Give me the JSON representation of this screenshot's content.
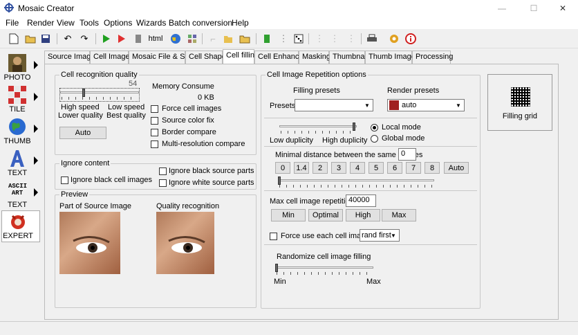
{
  "window": {
    "title": "Mosaic Creator",
    "minimize": "—",
    "maximize": "☐",
    "close": "✕"
  },
  "menu": [
    "File",
    "Render",
    "View",
    "Tools",
    "Options",
    "Wizards",
    "Batch conversion",
    "Help"
  ],
  "toolbar": {
    "html_label": "html"
  },
  "sidebar": {
    "items": [
      {
        "label": "PHOTO"
      },
      {
        "label": "TILE"
      },
      {
        "label": "THUMB"
      },
      {
        "label": "TEXT"
      },
      {
        "label": "TEXT",
        "icon_text": "ASCII ART"
      },
      {
        "label": "EXPERT"
      }
    ]
  },
  "tabs": [
    "Source Image",
    "Cell Images",
    "Mosaic File & Size",
    "Cell Shape",
    "Cell filling",
    "Cell Enhance",
    "Masking",
    "Thumbnail",
    "Thumb Images",
    "Processing"
  ],
  "active_tab": "Cell filling",
  "recognition": {
    "title": "Cell recognition quality",
    "value": "54",
    "level": 0.3,
    "left_top": "High speed",
    "left_bottom": "Lower quality",
    "right_top": "Low speed",
    "right_bottom": "Best quality",
    "auto": "Auto"
  },
  "memory": {
    "title": "Memory Consume",
    "value": "0 KB"
  },
  "checks": [
    "Force cell images",
    "Source color fix",
    "Border compare",
    "Multi-resolution compare"
  ],
  "ignore": {
    "title": "Ignore content",
    "black_cell": "Ignore black cell images",
    "black_source": "Ignore black source parts",
    "white_source": "Ignore white source parts"
  },
  "preview": {
    "title": "Preview",
    "source": "Part of Source Image",
    "quality": "Quality recognition"
  },
  "repetition": {
    "title": "Cell Image Repetition options",
    "filling_presets": "Filling presets",
    "render_presets": "Render presets",
    "presets": "Presets",
    "presets_value": "",
    "render_value": "auto",
    "low_dup": "Low duplicity",
    "high_dup": "High duplicity",
    "duplicity_level": 1.0,
    "local_mode": "Local mode",
    "global_mode": "Global mode",
    "min_distance_label": "Minimal distance between the same images",
    "min_distance_value": "0",
    "distance_buttons": [
      "0",
      "1.4",
      "2",
      "3",
      "4",
      "5",
      "6",
      "7",
      "8",
      "Auto"
    ],
    "distance_level": 0,
    "max_rep_label": "Max cell image repetition",
    "max_rep_value": "40000",
    "rep_buttons": [
      "Min",
      "Optimal",
      "High",
      "Max"
    ],
    "force_each": "Force use each cell image",
    "force_each_value": "rand first",
    "randomize": "Randomize cell image filling",
    "randomize_level": 0,
    "min": "Min",
    "max": "Max"
  },
  "filling_grid": "Filling grid"
}
